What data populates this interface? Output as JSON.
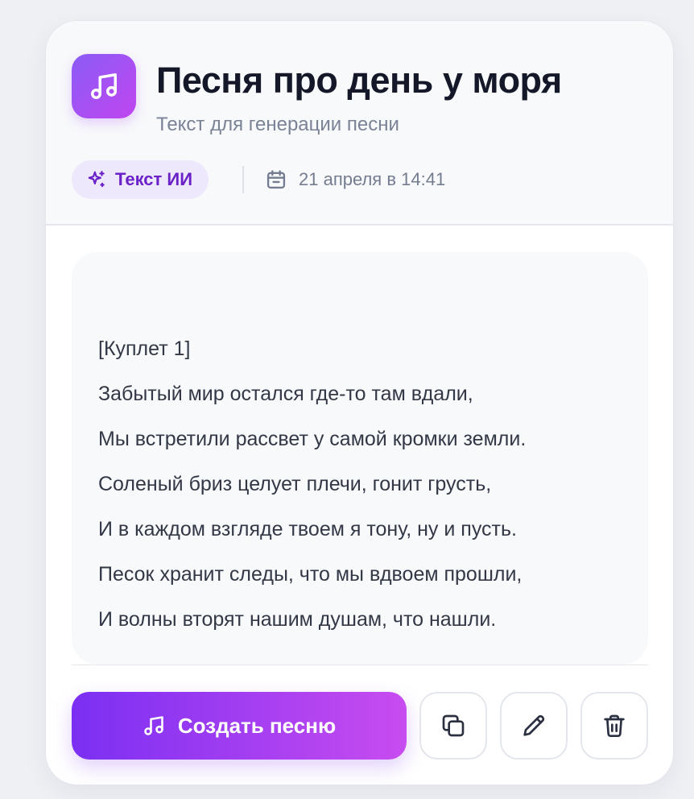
{
  "header": {
    "icon": "music-note-icon",
    "title": "Песня про день у моря",
    "subtitle": "Текст для генерации песни",
    "badge": {
      "icon": "sparkles-icon",
      "label": "Текст ИИ"
    },
    "date": {
      "icon": "calendar-icon",
      "text": "21 апреля в 14:41"
    }
  },
  "lyrics": [
    "[Куплет 1]",
    "Забытый мир остался где-то там вдали,",
    "Мы встретили рассвет у самой кромки земли.",
    "Соленый бриз целует плечи, гонит грусть,",
    "И в каждом взгляде твоем я тону, ну и пусть.",
    "Песок хранит следы, что мы вдвоем прошли,",
    "И волны вторят нашим душам, что нашли."
  ],
  "actions": {
    "create_label": "Создать песню",
    "create_icon": "music-note-icon",
    "copy_icon": "copy-icon",
    "edit_icon": "pencil-icon",
    "delete_icon": "trash-icon"
  },
  "colors": {
    "accent_start": "#7b2ff2",
    "accent_end": "#c84cf0",
    "badge_text": "#6b21c8",
    "badge_bg": "#ede8fc"
  }
}
